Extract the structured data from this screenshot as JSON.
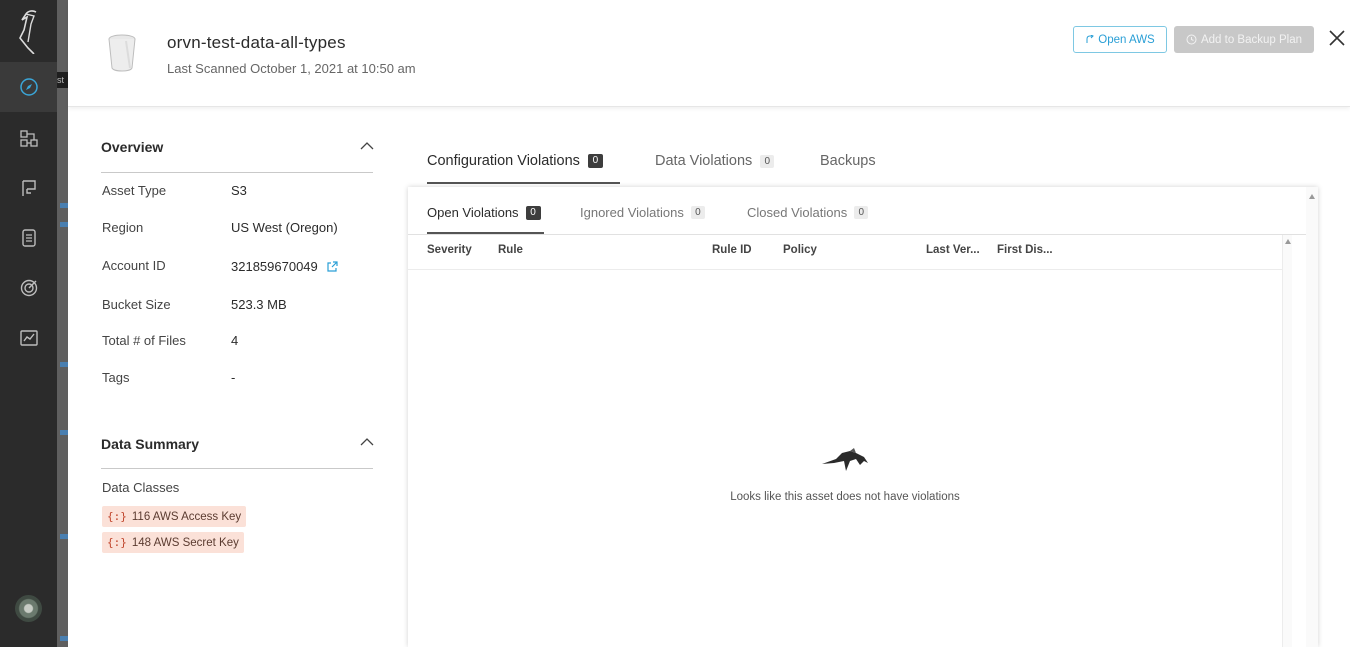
{
  "sidebar": {
    "logo": "crane-logo-icon",
    "items": [
      {
        "icon": "compass-icon",
        "active": true
      },
      {
        "icon": "workflow-icon",
        "active": false
      },
      {
        "icon": "flag-icon",
        "active": false
      },
      {
        "icon": "document-icon",
        "active": false
      },
      {
        "icon": "target-icon",
        "active": false
      },
      {
        "icon": "chart-icon",
        "active": false
      }
    ],
    "avatar": "user-avatar"
  },
  "background_peek_text": "st",
  "header": {
    "title": "orvn-test-data-all-types",
    "last_scanned": "Last Scanned October 1, 2021 at 10:50 am",
    "open_aws_label": "Open AWS",
    "backup_label": "Add to Backup Plan"
  },
  "overview": {
    "title": "Overview",
    "rows": [
      {
        "label": "Asset Type",
        "value": "S3"
      },
      {
        "label": "Region",
        "value": "US West (Oregon)"
      },
      {
        "label": "Account ID",
        "value": "321859670049"
      },
      {
        "label": "Bucket Size",
        "value": "523.3 MB"
      },
      {
        "label": "Total # of Files",
        "value": "4"
      },
      {
        "label": "Tags",
        "value": "-"
      }
    ]
  },
  "data_summary": {
    "title": "Data Summary",
    "classes_label": "Data Classes",
    "tags": [
      {
        "symbol": "{:}",
        "text": "116 AWS Access Key"
      },
      {
        "symbol": "{:}",
        "text": "148 AWS Secret Key"
      }
    ]
  },
  "tabs": [
    {
      "label": "Configuration Violations",
      "count": "0",
      "active": true
    },
    {
      "label": "Data Violations",
      "count": "0",
      "active": false
    },
    {
      "label": "Backups",
      "count": null,
      "active": false
    }
  ],
  "subtabs": [
    {
      "label": "Open Violations",
      "count": "0",
      "active": true
    },
    {
      "label": "Ignored Violations",
      "count": "0",
      "active": false
    },
    {
      "label": "Closed Violations",
      "count": "0",
      "active": false
    }
  ],
  "columns": [
    "Severity",
    "Rule",
    "Rule ID",
    "Policy",
    "Last Ver...",
    "First Dis..."
  ],
  "empty_state": "Looks like this asset does not have violations",
  "colors": {
    "sidebar_bg": "#2b2b2b",
    "accent_blue": "#2a9fd6",
    "tag_bg": "#fbe1d8",
    "tag_symbol": "#c0442b"
  }
}
